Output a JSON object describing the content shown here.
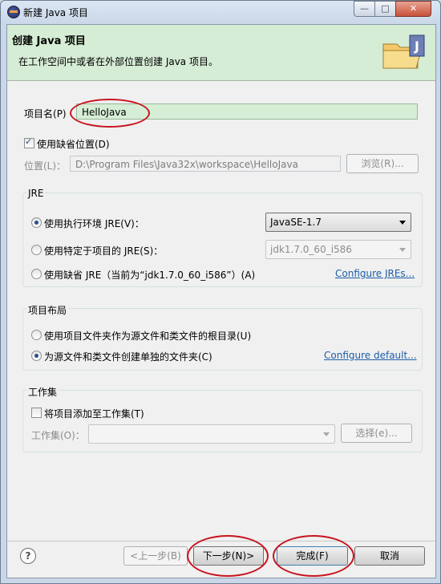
{
  "window": {
    "title": "新建 Java 项目",
    "minimize": "—",
    "maximize": "□",
    "close": "✕"
  },
  "banner": {
    "title": "创建 Java 项目",
    "subtitle": "在工作空间中或者在外部位置创建 Java 项目。",
    "icon": "java-project-folder-icon"
  },
  "project": {
    "name_label": "项目名",
    "name_key": "(P)",
    "name_value": "HelloJava"
  },
  "location": {
    "use_default_label": "使用缺省位置(D)",
    "use_default_checked": true,
    "label": "位置(L)：",
    "value": "D:\\Program Files\\Java32x\\workspace\\HelloJava",
    "browse_button": "浏览(R)..."
  },
  "jre": {
    "group_label": "JRE",
    "option1_label": "使用执行环境 JRE(V)：",
    "option1_value": "JavaSE-1.7",
    "option2_label": "使用特定于项目的 JRE(S)：",
    "option2_value": "jdk1.7.0_60_i586",
    "option3_label": "使用缺省 JRE（当前为“jdk1.7.0_60_i586”）(A)",
    "configure_link": "Configure JREs...",
    "selected": 1
  },
  "layout": {
    "group_label": "项目布局",
    "option1_label": "使用项目文件夹作为源文件和类文件的根目录(U)",
    "option2_label": "为源文件和类文件创建单独的文件夹(C)",
    "configure_link": "Configure default...",
    "selected": 2
  },
  "working_set": {
    "group_label": "工作集",
    "add_label": "将项目添加至工作集(T)",
    "add_checked": false,
    "label": "工作集(O)：",
    "value": "",
    "select_button": "选择(e)..."
  },
  "footer": {
    "help_icon": "help-icon",
    "help_glyph": "?",
    "back_button": "<上一步(B)",
    "next_button": "下一步(N)>",
    "finish_button": "完成(F)",
    "cancel_button": "取消"
  },
  "colors": {
    "banner_bg": "#d5ecd5",
    "highlight_ellipse": "#c8141f",
    "link": "#1d5ea8"
  }
}
